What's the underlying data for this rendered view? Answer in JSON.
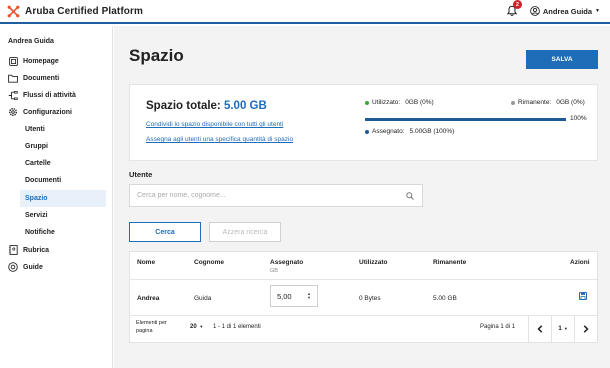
{
  "header": {
    "app_title": "Aruba Certified Platform",
    "notification_count": "2",
    "user_name": "Andrea Guida",
    "brand_color": "#1f5fa0",
    "logo_color": "#e8532b"
  },
  "sidebar": {
    "user": "Andrea Guida",
    "items": [
      {
        "label": "Homepage",
        "icon": "home-icon"
      },
      {
        "label": "Documenti",
        "icon": "folder-icon"
      },
      {
        "label": "Flussi di attività",
        "icon": "flow-icon"
      },
      {
        "label": "Configurazioni",
        "icon": "gear-icon"
      }
    ],
    "sub_items": [
      {
        "label": "Utenti"
      },
      {
        "label": "Gruppi"
      },
      {
        "label": "Cartelle"
      },
      {
        "label": "Documenti"
      },
      {
        "label": "Spazio",
        "active": true
      },
      {
        "label": "Servizi"
      },
      {
        "label": "Notifiche"
      }
    ],
    "bottom_items": [
      {
        "label": "Rubrica",
        "icon": "address-book-icon"
      },
      {
        "label": "Guide",
        "icon": "help-icon"
      }
    ]
  },
  "main": {
    "title": "Spazio",
    "save_label": "SALVA",
    "summary": {
      "total_label": "Spazio totale:",
      "total_value": "5.00 GB",
      "link_share": "Condividi lo spazio disponibile con tutti gli utenti",
      "link_assign": "Assegna agli utenti una specifica quantità di spazio",
      "used_label": "Utilizzato:",
      "used_value": "0GB (0%)",
      "remaining_label": "Rimanente:",
      "remaining_value": "0GB (0%)",
      "assigned_label": "Assegnato:",
      "assigned_value": "5.00GB (100%)",
      "progress_percent": 100,
      "progress_label": "100%",
      "used_color": "#3aa935",
      "remaining_color": "#999999",
      "assigned_color": "#1f5a96"
    },
    "search": {
      "label": "Utente",
      "placeholder": "Cerca per nome, cognome...",
      "value": "",
      "search_button": "Cerca",
      "reset_button": "Azzera ricerca"
    },
    "table": {
      "columns": {
        "nome": "Nome",
        "cognome": "Cognome",
        "assegnato": "Assegnato",
        "assegnato_unit": "GB",
        "utilizzato": "Utilizzato",
        "rimanente": "Rimanente",
        "azioni": "Azioni"
      },
      "rows": [
        {
          "nome": "Andrea",
          "cognome": "Guida",
          "assegnato": "5,00",
          "utilizzato": "0 Bytes",
          "rimanente": "5.00 GB"
        }
      ],
      "pager": {
        "page_size_label": "Elementi per pagina",
        "page_size": "20",
        "range": "1 - 1 di 1 elementi",
        "page_info": "Pagina 1 di 1",
        "current_page": "1"
      }
    }
  }
}
